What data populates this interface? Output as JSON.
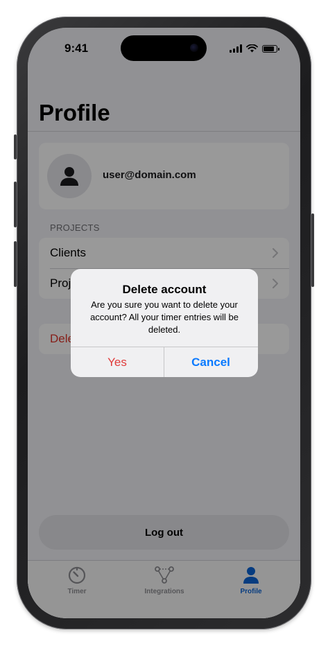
{
  "status_bar": {
    "time": "9:41"
  },
  "profile": {
    "title": "Profile",
    "email": "user@domain.com"
  },
  "sections": {
    "projects_header": "PROJECTS",
    "clients_label": "Clients",
    "projects_label": "Projects",
    "delete_label": "Delete account"
  },
  "logout_label": "Log out",
  "tabs": [
    {
      "label": "Timer",
      "icon": "timer-icon"
    },
    {
      "label": "Integrations",
      "icon": "integrations-icon"
    },
    {
      "label": "Profile",
      "icon": "person-icon"
    }
  ],
  "alert": {
    "title": "Delete account",
    "message": "Are you sure you want to delete your account? All your timer entries will be deleted.",
    "yes_label": "Yes",
    "cancel_label": "Cancel"
  },
  "colors": {
    "accent": "#0a64d6",
    "destructive": "#e03b3b",
    "alert_cancel": "#0a7aff"
  }
}
